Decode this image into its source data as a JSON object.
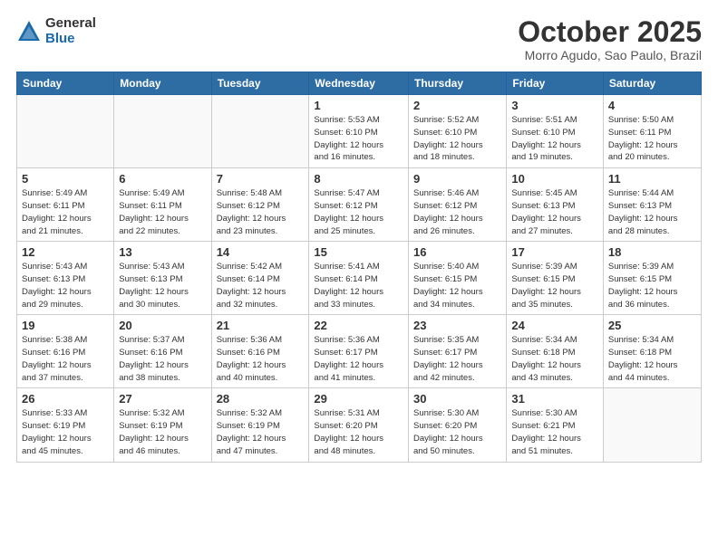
{
  "logo": {
    "general": "General",
    "blue": "Blue"
  },
  "header": {
    "month": "October 2025",
    "location": "Morro Agudo, Sao Paulo, Brazil"
  },
  "days_of_week": [
    "Sunday",
    "Monday",
    "Tuesday",
    "Wednesday",
    "Thursday",
    "Friday",
    "Saturday"
  ],
  "weeks": [
    [
      {
        "day": "",
        "info": ""
      },
      {
        "day": "",
        "info": ""
      },
      {
        "day": "",
        "info": ""
      },
      {
        "day": "1",
        "info": "Sunrise: 5:53 AM\nSunset: 6:10 PM\nDaylight: 12 hours\nand 16 minutes."
      },
      {
        "day": "2",
        "info": "Sunrise: 5:52 AM\nSunset: 6:10 PM\nDaylight: 12 hours\nand 18 minutes."
      },
      {
        "day": "3",
        "info": "Sunrise: 5:51 AM\nSunset: 6:10 PM\nDaylight: 12 hours\nand 19 minutes."
      },
      {
        "day": "4",
        "info": "Sunrise: 5:50 AM\nSunset: 6:11 PM\nDaylight: 12 hours\nand 20 minutes."
      }
    ],
    [
      {
        "day": "5",
        "info": "Sunrise: 5:49 AM\nSunset: 6:11 PM\nDaylight: 12 hours\nand 21 minutes."
      },
      {
        "day": "6",
        "info": "Sunrise: 5:49 AM\nSunset: 6:11 PM\nDaylight: 12 hours\nand 22 minutes."
      },
      {
        "day": "7",
        "info": "Sunrise: 5:48 AM\nSunset: 6:12 PM\nDaylight: 12 hours\nand 23 minutes."
      },
      {
        "day": "8",
        "info": "Sunrise: 5:47 AM\nSunset: 6:12 PM\nDaylight: 12 hours\nand 25 minutes."
      },
      {
        "day": "9",
        "info": "Sunrise: 5:46 AM\nSunset: 6:12 PM\nDaylight: 12 hours\nand 26 minutes."
      },
      {
        "day": "10",
        "info": "Sunrise: 5:45 AM\nSunset: 6:13 PM\nDaylight: 12 hours\nand 27 minutes."
      },
      {
        "day": "11",
        "info": "Sunrise: 5:44 AM\nSunset: 6:13 PM\nDaylight: 12 hours\nand 28 minutes."
      }
    ],
    [
      {
        "day": "12",
        "info": "Sunrise: 5:43 AM\nSunset: 6:13 PM\nDaylight: 12 hours\nand 29 minutes."
      },
      {
        "day": "13",
        "info": "Sunrise: 5:43 AM\nSunset: 6:13 PM\nDaylight: 12 hours\nand 30 minutes."
      },
      {
        "day": "14",
        "info": "Sunrise: 5:42 AM\nSunset: 6:14 PM\nDaylight: 12 hours\nand 32 minutes."
      },
      {
        "day": "15",
        "info": "Sunrise: 5:41 AM\nSunset: 6:14 PM\nDaylight: 12 hours\nand 33 minutes."
      },
      {
        "day": "16",
        "info": "Sunrise: 5:40 AM\nSunset: 6:15 PM\nDaylight: 12 hours\nand 34 minutes."
      },
      {
        "day": "17",
        "info": "Sunrise: 5:39 AM\nSunset: 6:15 PM\nDaylight: 12 hours\nand 35 minutes."
      },
      {
        "day": "18",
        "info": "Sunrise: 5:39 AM\nSunset: 6:15 PM\nDaylight: 12 hours\nand 36 minutes."
      }
    ],
    [
      {
        "day": "19",
        "info": "Sunrise: 5:38 AM\nSunset: 6:16 PM\nDaylight: 12 hours\nand 37 minutes."
      },
      {
        "day": "20",
        "info": "Sunrise: 5:37 AM\nSunset: 6:16 PM\nDaylight: 12 hours\nand 38 minutes."
      },
      {
        "day": "21",
        "info": "Sunrise: 5:36 AM\nSunset: 6:16 PM\nDaylight: 12 hours\nand 40 minutes."
      },
      {
        "day": "22",
        "info": "Sunrise: 5:36 AM\nSunset: 6:17 PM\nDaylight: 12 hours\nand 41 minutes."
      },
      {
        "day": "23",
        "info": "Sunrise: 5:35 AM\nSunset: 6:17 PM\nDaylight: 12 hours\nand 42 minutes."
      },
      {
        "day": "24",
        "info": "Sunrise: 5:34 AM\nSunset: 6:18 PM\nDaylight: 12 hours\nand 43 minutes."
      },
      {
        "day": "25",
        "info": "Sunrise: 5:34 AM\nSunset: 6:18 PM\nDaylight: 12 hours\nand 44 minutes."
      }
    ],
    [
      {
        "day": "26",
        "info": "Sunrise: 5:33 AM\nSunset: 6:19 PM\nDaylight: 12 hours\nand 45 minutes."
      },
      {
        "day": "27",
        "info": "Sunrise: 5:32 AM\nSunset: 6:19 PM\nDaylight: 12 hours\nand 46 minutes."
      },
      {
        "day": "28",
        "info": "Sunrise: 5:32 AM\nSunset: 6:19 PM\nDaylight: 12 hours\nand 47 minutes."
      },
      {
        "day": "29",
        "info": "Sunrise: 5:31 AM\nSunset: 6:20 PM\nDaylight: 12 hours\nand 48 minutes."
      },
      {
        "day": "30",
        "info": "Sunrise: 5:30 AM\nSunset: 6:20 PM\nDaylight: 12 hours\nand 50 minutes."
      },
      {
        "day": "31",
        "info": "Sunrise: 5:30 AM\nSunset: 6:21 PM\nDaylight: 12 hours\nand 51 minutes."
      },
      {
        "day": "",
        "info": ""
      }
    ]
  ]
}
